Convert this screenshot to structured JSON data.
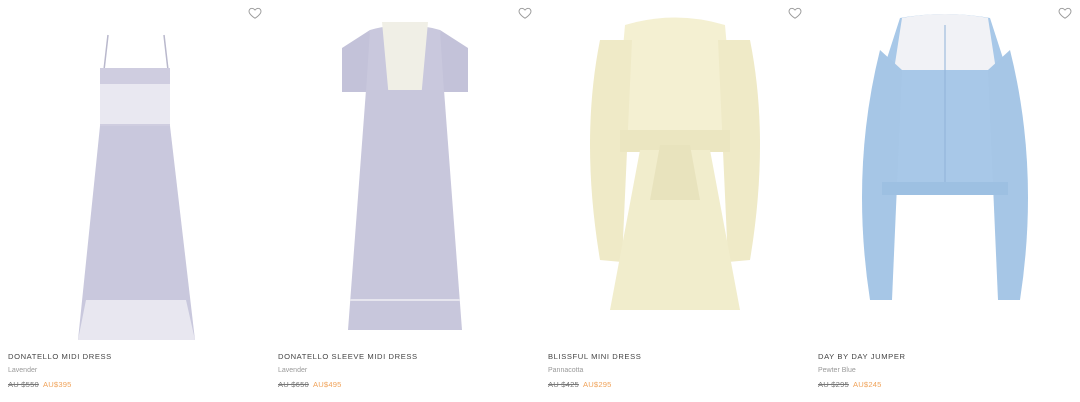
{
  "colors": {
    "sale": "#f0a35a",
    "lavender": "#c9c8dd",
    "cream": "#f3efcf",
    "blue": "#a8c8e8"
  },
  "products": [
    {
      "name": "DONATELLO MIDI DRESS",
      "color": "Lavender",
      "was_price": "AU $550",
      "now_price": "AU$395",
      "wishlist_icon": "heart-outline-icon"
    },
    {
      "name": "DONATELLO SLEEVE MIDI DRESS",
      "color": "Lavender",
      "was_price": "AU $650",
      "now_price": "AU$495",
      "wishlist_icon": "heart-outline-icon"
    },
    {
      "name": "BLISSFUL MINI DRESS",
      "color": "Pannacotta",
      "was_price": "AU $425",
      "now_price": "AU$295",
      "wishlist_icon": "heart-outline-icon"
    },
    {
      "name": "DAY BY DAY JUMPER",
      "color": "Pewter Blue",
      "was_price": "AU $295",
      "now_price": "AU$245",
      "wishlist_icon": "heart-outline-icon"
    }
  ]
}
